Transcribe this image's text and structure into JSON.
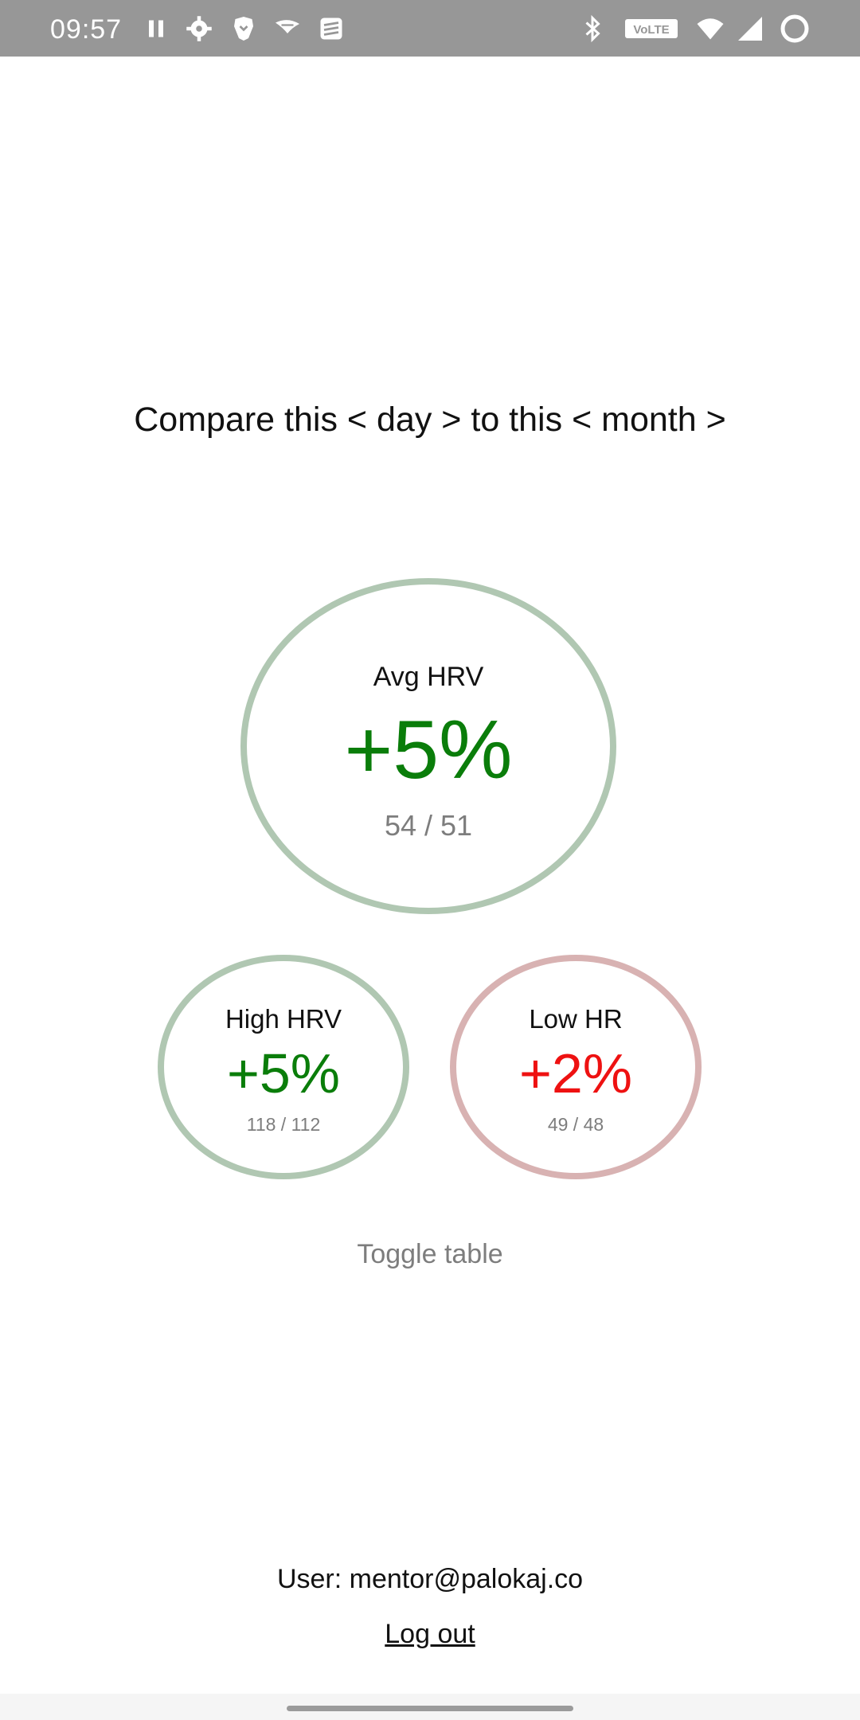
{
  "status_bar": {
    "time": "09:57",
    "left_icons": [
      "pause-icon",
      "settings-gear-icon",
      "brave-lion-icon",
      "bird-app-icon",
      "todoist-icon"
    ],
    "right_icons": [
      "bluetooth-icon",
      "volte-icon",
      "wifi-icon",
      "cellular-signal-icon",
      "loading-ring-icon"
    ],
    "volte_text": "VoLTE"
  },
  "compare": {
    "prefix": "Compare this",
    "period_a": "day",
    "middle": "to this",
    "period_b": "month",
    "left_arrow": "<",
    "right_arrow": ">"
  },
  "metrics": {
    "avg_hrv": {
      "label": "Avg HRV",
      "value": "+5%",
      "detail": "54 / 51",
      "status_color": "#0a7d0a",
      "ring_color": "#b0c7b2"
    },
    "high_hrv": {
      "label": "High HRV",
      "value": "+5%",
      "detail": "118 / 112",
      "status_color": "#0a7d0a",
      "ring_color": "#b0c7b2"
    },
    "low_hr": {
      "label": "Low HR",
      "value": "+2%",
      "detail": "49 / 48",
      "status_color": "#ee1111",
      "ring_color": "#d8b2b2"
    }
  },
  "toggle_label": "Toggle table",
  "user": {
    "prefix": "User:",
    "email": "mentor@palokaj.co"
  },
  "logout_label": "Log out"
}
